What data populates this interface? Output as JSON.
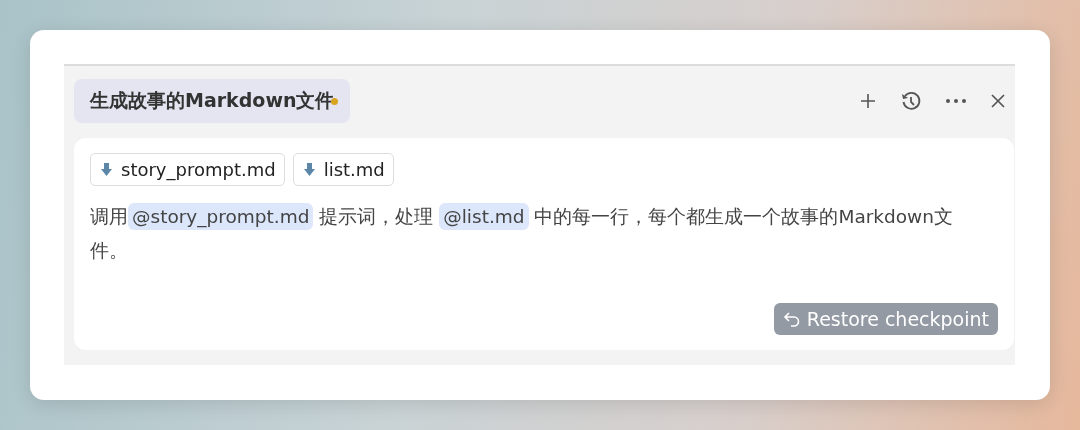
{
  "chat_title": {
    "text": "生成故事的Markdown文件",
    "unsaved": true
  },
  "header_actions": [
    {
      "kind": "add"
    },
    {
      "kind": "history"
    },
    {
      "kind": "more"
    },
    {
      "kind": "close"
    }
  ],
  "attachments": [
    {
      "name": "story_prompt.md"
    },
    {
      "name": "list.md"
    }
  ],
  "message": [
    {
      "kind": "text",
      "text": "调用"
    },
    {
      "kind": "mention",
      "text": "@story_prompt.md"
    },
    {
      "kind": "text",
      "text": " 提示词，处理 "
    },
    {
      "kind": "mention",
      "text": "@list.md"
    },
    {
      "kind": "text",
      "text": " 中的每一行，每个都生成一个故事的Markdown文件。"
    }
  ],
  "restore_button": {
    "label": "Restore checkpoint"
  }
}
